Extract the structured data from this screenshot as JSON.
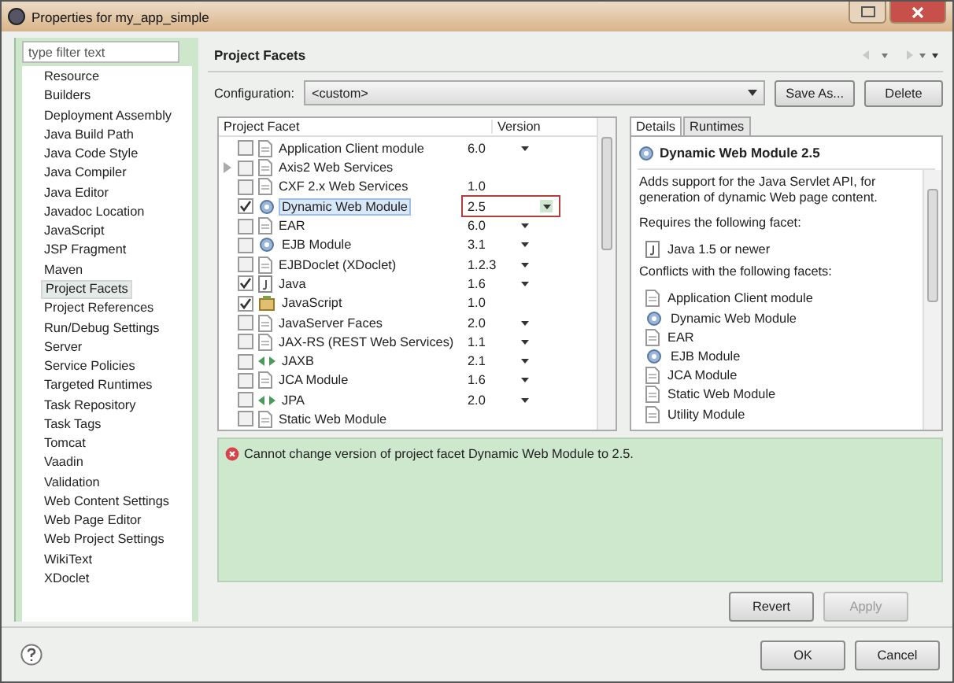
{
  "window": {
    "title": "Properties for my_app_simple"
  },
  "sidebar": {
    "filter": {
      "placeholder": "type filter text"
    },
    "items": [
      {
        "label": "Resource",
        "selected": false
      },
      {
        "label": "Builders",
        "selected": false
      },
      {
        "label": "Deployment Assembly",
        "selected": false
      },
      {
        "label": "Java Build Path",
        "selected": false
      },
      {
        "label": "Java Code Style",
        "selected": false
      },
      {
        "label": "Java Compiler",
        "selected": false
      },
      {
        "label": "Java Editor",
        "selected": false
      },
      {
        "label": "Javadoc Location",
        "selected": false
      },
      {
        "label": "JavaScript",
        "selected": false
      },
      {
        "label": "JSP Fragment",
        "selected": false
      },
      {
        "label": "Maven",
        "selected": false
      },
      {
        "label": "Project Facets",
        "selected": true
      },
      {
        "label": "Project References",
        "selected": false
      },
      {
        "label": "Run/Debug Settings",
        "selected": false
      },
      {
        "label": "Server",
        "selected": false
      },
      {
        "label": "Service Policies",
        "selected": false
      },
      {
        "label": "Targeted Runtimes",
        "selected": false
      },
      {
        "label": "Task Repository",
        "selected": false
      },
      {
        "label": "Task Tags",
        "selected": false
      },
      {
        "label": "Tomcat",
        "selected": false
      },
      {
        "label": "Vaadin",
        "selected": false
      },
      {
        "label": "Validation",
        "selected": false
      },
      {
        "label": "Web Content Settings",
        "selected": false
      },
      {
        "label": "Web Page Editor",
        "selected": false
      },
      {
        "label": "Web Project Settings",
        "selected": false
      },
      {
        "label": "WikiText",
        "selected": false
      },
      {
        "label": "XDoclet",
        "selected": false
      }
    ]
  },
  "page": {
    "title": "Project Facets",
    "configuration": {
      "label": "Configuration:",
      "value": "<custom>"
    },
    "buttons": [
      "Save As...",
      "Delete"
    ]
  },
  "facets": {
    "columns": [
      "Project Facet",
      "Version"
    ],
    "rows": [
      {
        "name": "Application Client module",
        "version": "6.0",
        "dropdown": true,
        "checked": false,
        "selected": false,
        "expandable": false,
        "kind": "page"
      },
      {
        "name": "Axis2 Web Services",
        "version": "",
        "dropdown": false,
        "checked": false,
        "selected": false,
        "expandable": true,
        "kind": "page"
      },
      {
        "name": "CXF 2.x Web Services",
        "version": "1.0",
        "dropdown": false,
        "checked": false,
        "selected": false,
        "expandable": false,
        "kind": "page"
      },
      {
        "name": "Dynamic Web Module",
        "version": "2.5",
        "dropdown": true,
        "checked": true,
        "selected": true,
        "expandable": false,
        "kind": "module"
      },
      {
        "name": "EAR",
        "version": "6.0",
        "dropdown": true,
        "checked": false,
        "selected": false,
        "expandable": false,
        "kind": "page"
      },
      {
        "name": "EJB Module",
        "version": "3.1",
        "dropdown": true,
        "checked": false,
        "selected": false,
        "expandable": false,
        "kind": "module"
      },
      {
        "name": "EJBDoclet (XDoclet)",
        "version": "1.2.3",
        "dropdown": true,
        "checked": false,
        "selected": false,
        "expandable": false,
        "kind": "page"
      },
      {
        "name": "Java",
        "version": "1.6",
        "dropdown": true,
        "checked": true,
        "selected": false,
        "expandable": false,
        "kind": "java"
      },
      {
        "name": "JavaScript",
        "version": "1.0",
        "dropdown": false,
        "checked": true,
        "selected": false,
        "expandable": false,
        "kind": "script"
      },
      {
        "name": "JavaServer Faces",
        "version": "2.0",
        "dropdown": true,
        "checked": false,
        "selected": false,
        "expandable": false,
        "kind": "page"
      },
      {
        "name": "JAX-RS (REST Web Services)",
        "version": "1.1",
        "dropdown": true,
        "checked": false,
        "selected": false,
        "expandable": false,
        "kind": "page"
      },
      {
        "name": "JAXB",
        "version": "2.1",
        "dropdown": true,
        "checked": false,
        "selected": false,
        "expandable": false,
        "kind": "binding"
      },
      {
        "name": "JCA Module",
        "version": "1.6",
        "dropdown": true,
        "checked": false,
        "selected": false,
        "expandable": false,
        "kind": "page"
      },
      {
        "name": "JPA",
        "version": "2.0",
        "dropdown": true,
        "checked": false,
        "selected": false,
        "expandable": false,
        "kind": "binding"
      },
      {
        "name": "Static Web Module",
        "version": "",
        "dropdown": false,
        "checked": false,
        "selected": false,
        "expandable": false,
        "kind": "page"
      }
    ]
  },
  "details": {
    "tabs": [
      {
        "label": "Details",
        "selected": true
      },
      {
        "label": "Runtimes",
        "selected": false
      }
    ],
    "title": "Dynamic Web Module 2.5",
    "description": "Adds support for the Java Servlet API, for generation of dynamic Web page content.",
    "requires_label": "Requires the following facet:",
    "requires": [
      {
        "name": "Java 1.5 or newer",
        "kind": "java"
      }
    ],
    "conflicts_label": "Conflicts with the following facets:",
    "conflicts": [
      {
        "name": "Application Client module",
        "kind": "page"
      },
      {
        "name": "Dynamic Web Module",
        "kind": "module"
      },
      {
        "name": "EAR",
        "kind": "page"
      },
      {
        "name": "EJB Module",
        "kind": "module"
      },
      {
        "name": "JCA Module",
        "kind": "page"
      },
      {
        "name": "Static Web Module",
        "kind": "page"
      },
      {
        "name": "Utility Module",
        "kind": "page"
      }
    ]
  },
  "error": "Cannot change version of project facet Dynamic Web Module to 2.5.",
  "page_buttons": [
    "Revert",
    "Apply"
  ],
  "dialog_buttons": [
    "OK",
    "Cancel"
  ]
}
